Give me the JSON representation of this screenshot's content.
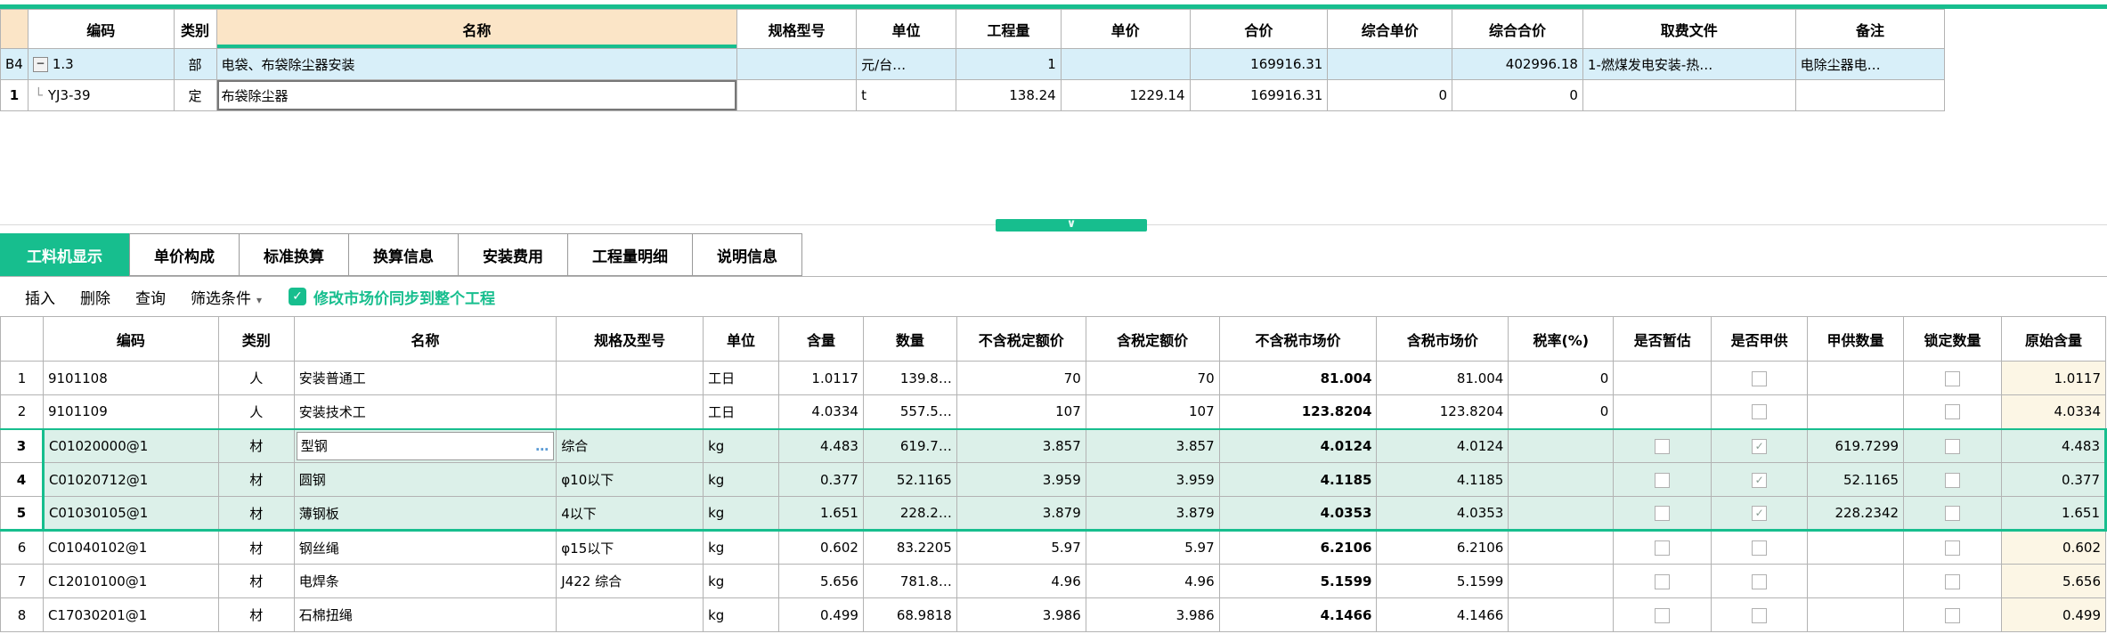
{
  "colors": {
    "accent_green": "#17BE8E",
    "header_peach": "#FBE5C7",
    "row_highlight_blue": "#D8EFF9",
    "selection_green": "#DCF0E9",
    "market_price_blue": "#0000D8",
    "origin_column_cream": "#FCF6E5"
  },
  "icons": {
    "collapse": "−",
    "tree_branch": "└",
    "dropdown_arrow": "▾",
    "splitter_chevron": "∨",
    "check": "✓",
    "ellipsis_button": "…"
  },
  "top_table": {
    "headers": [
      "编码",
      "类别",
      "名称",
      "规格型号",
      "单位",
      "工程量",
      "单价",
      "合价",
      "综合单价",
      "综合合价",
      "取费文件",
      "备注"
    ],
    "rows": [
      {
        "num": "B4",
        "code": "1.3",
        "cat": "部",
        "name": "电袋、布袋除尘器安装",
        "spec": "",
        "unit": "元/台…",
        "qty": "1",
        "price": "",
        "total": "169916.31",
        "comp_price": "",
        "comp_total": "402996.18",
        "fee_file": "1-燃煤发电安装-热…",
        "note": "电除尘器电…"
      },
      {
        "num": "1",
        "code": "YJ3-39",
        "cat": "定",
        "name": "布袋除尘器",
        "spec": "",
        "unit": "t",
        "qty": "138.24",
        "price": "1229.14",
        "total": "169916.31",
        "comp_price": "0",
        "comp_total": "0",
        "fee_file": "",
        "note": ""
      }
    ]
  },
  "tabs": {
    "items": [
      {
        "label": "工料机显示",
        "active": true
      },
      {
        "label": "单价构成",
        "active": false
      },
      {
        "label": "标准换算",
        "active": false
      },
      {
        "label": "换算信息",
        "active": false
      },
      {
        "label": "安装费用",
        "active": false
      },
      {
        "label": "工程量明细",
        "active": false
      },
      {
        "label": "说明信息",
        "active": false
      }
    ]
  },
  "toolbar": {
    "insert": "插入",
    "delete": "删除",
    "query": "查询",
    "filter": "筛选条件",
    "sync_checkbox_checked": true,
    "sync_label": "修改市场价同步到整个工程"
  },
  "bottom_table": {
    "headers": [
      "编码",
      "类别",
      "名称",
      "规格及型号",
      "单位",
      "含量",
      "数量",
      "不含税定额价",
      "含税定额价",
      "不含税市场价",
      "含税市场价",
      "税率(%)",
      "是否暂估",
      "是否甲供",
      "甲供数量",
      "锁定数量",
      "原始含量"
    ],
    "rows": [
      {
        "num": "1",
        "code": "9101108",
        "cat": "人",
        "name": "安装普通工",
        "spec": "",
        "unit": "工日",
        "content": "1.0117",
        "qty": "139.8…",
        "price_ex": "70",
        "price_in": "70",
        "market_ex": "81.004",
        "market_in": "81.004",
        "tax": "0",
        "has_est": false,
        "est": false,
        "has_sup": true,
        "sup": false,
        "sup_qty": "",
        "has_lock": true,
        "lock": false,
        "orig": "1.0117"
      },
      {
        "num": "2",
        "code": "9101109",
        "cat": "人",
        "name": "安装技术工",
        "spec": "",
        "unit": "工日",
        "content": "4.0334",
        "qty": "557.5…",
        "price_ex": "107",
        "price_in": "107",
        "market_ex": "123.8204",
        "market_in": "123.8204",
        "tax": "0",
        "has_est": false,
        "est": false,
        "has_sup": true,
        "sup": false,
        "sup_qty": "",
        "has_lock": true,
        "lock": false,
        "orig": "4.0334"
      },
      {
        "num": "3",
        "code": "C01020000@1",
        "cat": "材",
        "name": "型钢",
        "spec": "综合",
        "unit": "kg",
        "content": "4.483",
        "qty": "619.7…",
        "price_ex": "3.857",
        "price_in": "3.857",
        "market_ex": "4.0124",
        "market_in": "4.0124",
        "tax": "",
        "has_est": true,
        "est": false,
        "has_sup": true,
        "sup": true,
        "sup_qty": "619.7299",
        "has_lock": true,
        "lock": false,
        "orig": "4.483"
      },
      {
        "num": "4",
        "code": "C01020712@1",
        "cat": "材",
        "name": "圆钢",
        "spec": "φ10以下",
        "unit": "kg",
        "content": "0.377",
        "qty": "52.1165",
        "price_ex": "3.959",
        "price_in": "3.959",
        "market_ex": "4.1185",
        "market_in": "4.1185",
        "tax": "",
        "has_est": true,
        "est": false,
        "has_sup": true,
        "sup": true,
        "sup_qty": "52.1165",
        "has_lock": true,
        "lock": false,
        "orig": "0.377"
      },
      {
        "num": "5",
        "code": "C01030105@1",
        "cat": "材",
        "name": "薄钢板",
        "spec": "4以下",
        "unit": "kg",
        "content": "1.651",
        "qty": "228.2…",
        "price_ex": "3.879",
        "price_in": "3.879",
        "market_ex": "4.0353",
        "market_in": "4.0353",
        "tax": "",
        "has_est": true,
        "est": false,
        "has_sup": true,
        "sup": true,
        "sup_qty": "228.2342",
        "has_lock": true,
        "lock": false,
        "orig": "1.651"
      },
      {
        "num": "6",
        "code": "C01040102@1",
        "cat": "材",
        "name": "钢丝绳",
        "spec": "φ15以下",
        "unit": "kg",
        "content": "0.602",
        "qty": "83.2205",
        "price_ex": "5.97",
        "price_in": "5.97",
        "market_ex": "6.2106",
        "market_in": "6.2106",
        "tax": "",
        "has_est": true,
        "est": false,
        "has_sup": true,
        "sup": false,
        "sup_qty": "",
        "has_lock": true,
        "lock": false,
        "orig": "0.602"
      },
      {
        "num": "7",
        "code": "C12010100@1",
        "cat": "材",
        "name": "电焊条",
        "spec": "J422 综合",
        "unit": "kg",
        "content": "5.656",
        "qty": "781.8…",
        "price_ex": "4.96",
        "price_in": "4.96",
        "market_ex": "5.1599",
        "market_in": "5.1599",
        "tax": "",
        "has_est": true,
        "est": false,
        "has_sup": true,
        "sup": false,
        "sup_qty": "",
        "has_lock": true,
        "lock": false,
        "orig": "5.656"
      },
      {
        "num": "8",
        "code": "C17030201@1",
        "cat": "材",
        "name": "石棉扭绳",
        "spec": "",
        "unit": "kg",
        "content": "0.499",
        "qty": "68.9818",
        "price_ex": "3.986",
        "price_in": "3.986",
        "market_ex": "4.1466",
        "market_in": "4.1466",
        "tax": "",
        "has_est": true,
        "est": false,
        "has_sup": true,
        "sup": false,
        "sup_qty": "",
        "has_lock": true,
        "lock": false,
        "orig": "0.499"
      }
    ]
  }
}
